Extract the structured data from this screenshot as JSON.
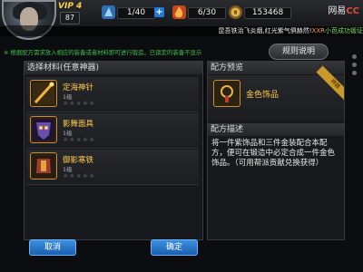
{
  "top": {
    "vip": "VIP 4",
    "level": "87",
    "energy": "1/40",
    "stamina": "6/30",
    "coins": "153468",
    "brand_a": "网易",
    "brand_b": "CC"
  },
  "ticker": {
    "prefix": "昆吾铁治飞炎烟,红光紫气俱赫然!",
    "player": "XXR",
    "suffix": "小芭成功锻证"
  },
  "hint": "※ 根据配方需求放入相应的装备或者材料即可进行锻造，已锁定的装备不显示",
  "rules_button": "规则说明",
  "left_panel": {
    "title": "选择材料(任意神器)",
    "items": [
      {
        "name": "定海神针",
        "level": "1级"
      },
      {
        "name": "影舞面具",
        "level": "1级"
      },
      {
        "name": "御影寒铁",
        "level": "1级"
      }
    ],
    "cancel": "取消",
    "confirm": "确定"
  },
  "right_panel": {
    "preview_title": "配方预览",
    "preview_item": "金色饰品",
    "ribbon": "神器",
    "desc_title": "配方描述",
    "desc_text": "将一件紫饰品和三件金装配合本配方，便可在锻造中必定合成一件金色饰品。（可用帮派贡献兑换获得）"
  },
  "colors": {
    "gold": "#ffca4a",
    "hint_green": "#3fbf4a",
    "button_blue": "#1b5fae"
  }
}
